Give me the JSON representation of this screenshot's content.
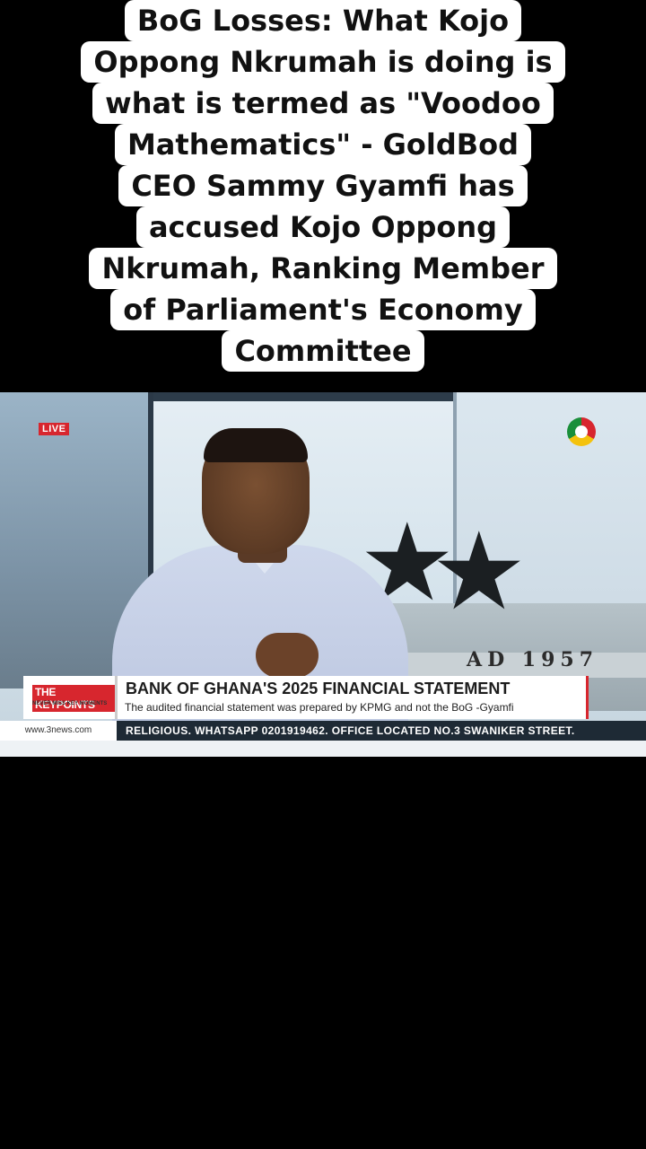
{
  "caption": {
    "lines": [
      "BoG Losses: What Kojo",
      "Oppong Nkrumah is doing is",
      "what is termed as \"Voodoo",
      "Mathematics\" - GoldBod",
      "CEO Sammy Gyamfi has",
      "accused Kojo Oppong",
      "Nkrumah, Ranking Member",
      "of Parliament's Economy",
      "Committee"
    ]
  },
  "video": {
    "live_badge": "LIVE",
    "building_text": "AD 1957",
    "lower_third": {
      "brand_title": "THE KEYPOINTS",
      "brand_tagline": "NEVER MISS KEY MOMENTS",
      "headline": "BANK OF GHANA'S 2025 FINANCIAL STATEMENT",
      "subline": "The audited financial statement was prepared by KPMG and not the BoG -Gyamfi"
    },
    "ticker": {
      "website": "www.3news.com",
      "text": "RELIGIOUS. WHATSAPP 0201919462. OFFICE LOCATED NO.3 SWANIKER STREET."
    }
  },
  "colors": {
    "accent_red": "#d7262e",
    "ticker_bg": "#1e2a35",
    "background": "#000000"
  }
}
